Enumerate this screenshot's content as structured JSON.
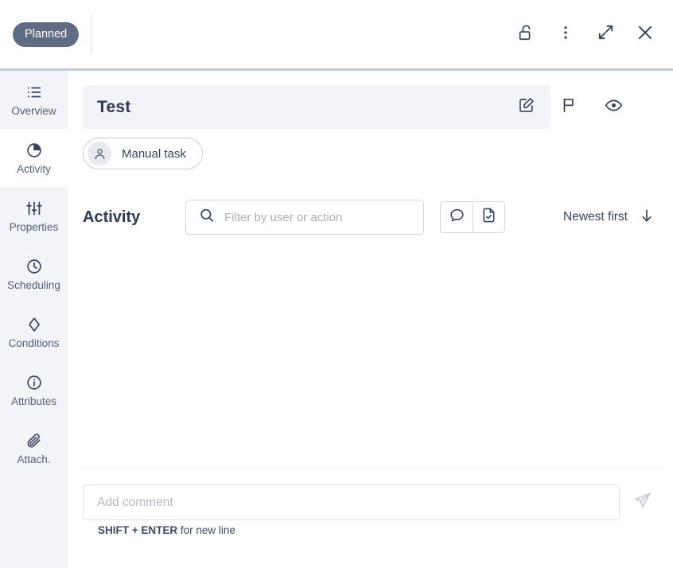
{
  "topbar": {
    "status_badge": "Planned",
    "actions": [
      {
        "name": "lock-open-icon",
        "label": "Unlock"
      },
      {
        "name": "more-vertical-icon",
        "label": "More options"
      },
      {
        "name": "expand-icon",
        "label": "Expand"
      },
      {
        "name": "close-icon",
        "label": "Close"
      }
    ]
  },
  "sidebar": {
    "items": [
      {
        "label": "Overview",
        "icon": "list-icon",
        "active": false
      },
      {
        "label": "Activity",
        "icon": "pie-chart-icon",
        "active": true
      },
      {
        "label": "Properties",
        "icon": "sliders-icon",
        "active": false
      },
      {
        "label": "Scheduling",
        "icon": "clock-icon",
        "active": false
      },
      {
        "label": "Conditions",
        "icon": "diamond-icon",
        "active": false
      },
      {
        "label": "Attributes",
        "icon": "info-icon",
        "active": false
      },
      {
        "label": "Attach.",
        "icon": "paperclip-icon",
        "active": false
      }
    ]
  },
  "main": {
    "title": "Test",
    "title_actions": [
      {
        "name": "edit-icon",
        "label": "Edit"
      },
      {
        "name": "flag-icon",
        "label": "Flag"
      },
      {
        "name": "eye-icon",
        "label": "Watch"
      }
    ],
    "chip": {
      "label": "Manual task",
      "avatar_icon": "user-icon"
    },
    "activity": {
      "heading": "Activity",
      "search_placeholder": "Filter by user or action",
      "search_value": "",
      "toggles": [
        {
          "name": "comment-icon",
          "label": "Comments"
        },
        {
          "name": "document-check-icon",
          "label": "Changes"
        }
      ],
      "sort_label": "Newest first",
      "sort_direction_icon": "arrow-down-icon"
    },
    "composer": {
      "placeholder": "Add comment",
      "value": "",
      "send_icon": "send-icon",
      "hint_bold": "SHIFT + ENTER",
      "hint_rest": " for new line"
    }
  },
  "colors": {
    "badge_bg": "#5f6c83",
    "icon": "#36445b",
    "panel_bg": "#f3f4f7",
    "divider": "#c3cad7"
  }
}
